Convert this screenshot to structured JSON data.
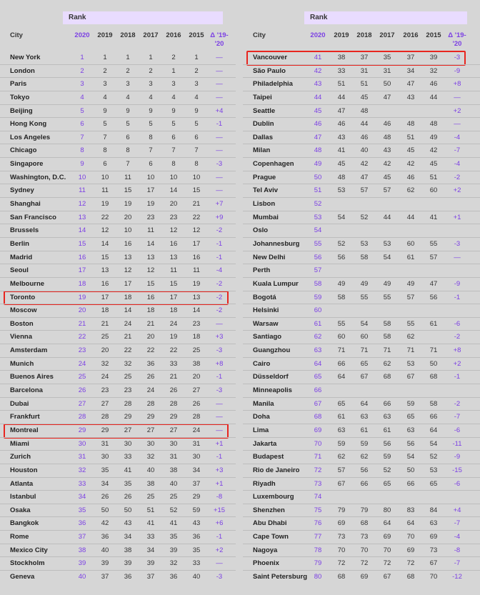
{
  "headers": {
    "rank": "Rank",
    "city": "City",
    "years": [
      "2020",
      "2019",
      "2018",
      "2017",
      "2016",
      "2015"
    ],
    "delta": "Δ '19-\n'20"
  },
  "highlighted_cities": [
    "Toronto",
    "Montreal",
    "Vancouver"
  ],
  "chart_data": {
    "type": "table",
    "columns": [
      "City",
      "2020",
      "2019",
      "2018",
      "2017",
      "2016",
      "2015",
      "Δ '19-'20"
    ],
    "tables": [
      {
        "rows": [
          [
            "New York",
            "1",
            "1",
            "1",
            "1",
            "2",
            "1",
            "—"
          ],
          [
            "London",
            "2",
            "2",
            "2",
            "2",
            "1",
            "2",
            "—"
          ],
          [
            "Paris",
            "3",
            "3",
            "3",
            "3",
            "3",
            "3",
            "—"
          ],
          [
            "Tokyo",
            "4",
            "4",
            "4",
            "4",
            "4",
            "4",
            "—"
          ],
          [
            "Beijing",
            "5",
            "9",
            "9",
            "9",
            "9",
            "9",
            "+4"
          ],
          [
            "Hong Kong",
            "6",
            "5",
            "5",
            "5",
            "5",
            "5",
            "-1"
          ],
          [
            "Los Angeles",
            "7",
            "7",
            "6",
            "8",
            "6",
            "6",
            "—"
          ],
          [
            "Chicago",
            "8",
            "8",
            "8",
            "7",
            "7",
            "7",
            "—"
          ],
          [
            "Singapore",
            "9",
            "6",
            "7",
            "6",
            "8",
            "8",
            "-3"
          ],
          [
            "Washington, D.C.",
            "10",
            "10",
            "11",
            "10",
            "10",
            "10",
            "—"
          ],
          [
            "Sydney",
            "11",
            "11",
            "15",
            "17",
            "14",
            "15",
            "—"
          ],
          [
            "Shanghai",
            "12",
            "19",
            "19",
            "19",
            "20",
            "21",
            "+7"
          ],
          [
            "San Francisco",
            "13",
            "22",
            "20",
            "23",
            "23",
            "22",
            "+9"
          ],
          [
            "Brussels",
            "14",
            "12",
            "10",
            "11",
            "12",
            "12",
            "-2"
          ],
          [
            "Berlin",
            "15",
            "14",
            "16",
            "14",
            "16",
            "17",
            "-1"
          ],
          [
            "Madrid",
            "16",
            "15",
            "13",
            "13",
            "13",
            "16",
            "-1"
          ],
          [
            "Seoul",
            "17",
            "13",
            "12",
            "12",
            "11",
            "11",
            "-4"
          ],
          [
            "Melbourne",
            "18",
            "16",
            "17",
            "15",
            "15",
            "19",
            "-2"
          ],
          [
            "Toronto",
            "19",
            "17",
            "18",
            "16",
            "17",
            "13",
            "-2"
          ],
          [
            "Moscow",
            "20",
            "18",
            "14",
            "18",
            "18",
            "14",
            "-2"
          ],
          [
            "Boston",
            "21",
            "21",
            "24",
            "21",
            "24",
            "23",
            "—"
          ],
          [
            "Vienna",
            "22",
            "25",
            "21",
            "20",
            "19",
            "18",
            "+3"
          ],
          [
            "Amsterdam",
            "23",
            "20",
            "22",
            "22",
            "22",
            "25",
            "-3"
          ],
          [
            "Munich",
            "24",
            "32",
            "32",
            "36",
            "33",
            "38",
            "+8"
          ],
          [
            "Buenos Aires",
            "25",
            "24",
            "25",
            "26",
            "21",
            "20",
            "-1"
          ],
          [
            "Barcelona",
            "26",
            "23",
            "23",
            "24",
            "26",
            "27",
            "-3"
          ],
          [
            "Dubai",
            "27",
            "27",
            "28",
            "28",
            "28",
            "26",
            "—"
          ],
          [
            "Frankfurt",
            "28",
            "28",
            "29",
            "29",
            "29",
            "28",
            "—"
          ],
          [
            "Montreal",
            "29",
            "29",
            "27",
            "27",
            "27",
            "24",
            "—"
          ],
          [
            "Miami",
            "30",
            "31",
            "30",
            "30",
            "30",
            "31",
            "+1"
          ],
          [
            "Zurich",
            "31",
            "30",
            "33",
            "32",
            "31",
            "30",
            "-1"
          ],
          [
            "Houston",
            "32",
            "35",
            "41",
            "40",
            "38",
            "34",
            "+3"
          ],
          [
            "Atlanta",
            "33",
            "34",
            "35",
            "38",
            "40",
            "37",
            "+1"
          ],
          [
            "Istanbul",
            "34",
            "26",
            "26",
            "25",
            "25",
            "29",
            "-8"
          ],
          [
            "Osaka",
            "35",
            "50",
            "50",
            "51",
            "52",
            "59",
            "+15"
          ],
          [
            "Bangkok",
            "36",
            "42",
            "43",
            "41",
            "41",
            "43",
            "+6"
          ],
          [
            "Rome",
            "37",
            "36",
            "34",
            "33",
            "35",
            "36",
            "-1"
          ],
          [
            "Mexico City",
            "38",
            "40",
            "38",
            "34",
            "39",
            "35",
            "+2"
          ],
          [
            "Stockholm",
            "39",
            "39",
            "39",
            "39",
            "32",
            "33",
            "—"
          ],
          [
            "Geneva",
            "40",
            "37",
            "36",
            "37",
            "36",
            "40",
            "-3"
          ]
        ]
      },
      {
        "rows": [
          [
            "Vancouver",
            "41",
            "38",
            "37",
            "35",
            "37",
            "39",
            "-3"
          ],
          [
            "São Paulo",
            "42",
            "33",
            "31",
            "31",
            "34",
            "32",
            "-9"
          ],
          [
            "Philadelphia",
            "43",
            "51",
            "51",
            "50",
            "47",
            "46",
            "+8"
          ],
          [
            "Taipei",
            "44",
            "44",
            "45",
            "47",
            "43",
            "44",
            "—"
          ],
          [
            "Seattle",
            "45",
            "47",
            "48",
            "",
            "",
            "",
            "+2"
          ],
          [
            "Dublin",
            "46",
            "46",
            "44",
            "46",
            "48",
            "48",
            "—"
          ],
          [
            "Dallas",
            "47",
            "43",
            "46",
            "48",
            "51",
            "49",
            "-4"
          ],
          [
            "Milan",
            "48",
            "41",
            "40",
            "43",
            "45",
            "42",
            "-7"
          ],
          [
            "Copenhagen",
            "49",
            "45",
            "42",
            "42",
            "42",
            "45",
            "-4"
          ],
          [
            "Prague",
            "50",
            "48",
            "47",
            "45",
            "46",
            "51",
            "-2"
          ],
          [
            "Tel Aviv",
            "51",
            "53",
            "57",
            "57",
            "62",
            "60",
            "+2"
          ],
          [
            "Lisbon",
            "52",
            "",
            "",
            "",
            "",
            "",
            ""
          ],
          [
            "Mumbai",
            "53",
            "54",
            "52",
            "44",
            "44",
            "41",
            "+1"
          ],
          [
            "Oslo",
            "54",
            "",
            "",
            "",
            "",
            "",
            ""
          ],
          [
            "Johannesburg",
            "55",
            "52",
            "53",
            "53",
            "60",
            "55",
            "-3"
          ],
          [
            "New Delhi",
            "56",
            "56",
            "58",
            "54",
            "61",
            "57",
            "—"
          ],
          [
            "Perth",
            "57",
            "",
            "",
            "",
            "",
            "",
            ""
          ],
          [
            "Kuala Lumpur",
            "58",
            "49",
            "49",
            "49",
            "49",
            "47",
            "-9"
          ],
          [
            "Bogotá",
            "59",
            "58",
            "55",
            "55",
            "57",
            "56",
            "-1"
          ],
          [
            "Helsinki",
            "60",
            "",
            "",
            "",
            "",
            "",
            ""
          ],
          [
            "Warsaw",
            "61",
            "55",
            "54",
            "58",
            "55",
            "61",
            "-6"
          ],
          [
            "Santiago",
            "62",
            "60",
            "60",
            "58",
            "62",
            "",
            "-2"
          ],
          [
            "Guangzhou",
            "63",
            "71",
            "71",
            "71",
            "71",
            "71",
            "+8"
          ],
          [
            "Cairo",
            "64",
            "66",
            "65",
            "62",
            "53",
            "50",
            "+2"
          ],
          [
            "Düsseldorf",
            "65",
            "64",
            "67",
            "68",
            "67",
            "68",
            "-1"
          ],
          [
            "Minneapolis",
            "66",
            "",
            "",
            "",
            "",
            "",
            ""
          ],
          [
            "Manila",
            "67",
            "65",
            "64",
            "66",
            "59",
            "58",
            "-2"
          ],
          [
            "Doha",
            "68",
            "61",
            "63",
            "63",
            "65",
            "66",
            "-7"
          ],
          [
            "Lima",
            "69",
            "63",
            "61",
            "61",
            "63",
            "64",
            "-6"
          ],
          [
            "Jakarta",
            "70",
            "59",
            "59",
            "56",
            "56",
            "54",
            "-11"
          ],
          [
            "Budapest",
            "71",
            "62",
            "62",
            "59",
            "54",
            "52",
            "-9"
          ],
          [
            "Rio de Janeiro",
            "72",
            "57",
            "56",
            "52",
            "50",
            "53",
            "-15"
          ],
          [
            "Riyadh",
            "73",
            "67",
            "66",
            "65",
            "66",
            "65",
            "-6"
          ],
          [
            "Luxembourg",
            "74",
            "",
            "",
            "",
            "",
            "",
            ""
          ],
          [
            "Shenzhen",
            "75",
            "79",
            "79",
            "80",
            "83",
            "84",
            "+4"
          ],
          [
            "Abu Dhabi",
            "76",
            "69",
            "68",
            "64",
            "64",
            "63",
            "-7"
          ],
          [
            "Cape Town",
            "77",
            "73",
            "73",
            "69",
            "70",
            "69",
            "-4"
          ],
          [
            "Nagoya",
            "78",
            "70",
            "70",
            "70",
            "69",
            "73",
            "-8"
          ],
          [
            "Phoenix",
            "79",
            "72",
            "72",
            "72",
            "72",
            "67",
            "-7"
          ],
          [
            "Saint Petersburg",
            "80",
            "68",
            "69",
            "67",
            "68",
            "70",
            "-12"
          ]
        ]
      }
    ]
  }
}
